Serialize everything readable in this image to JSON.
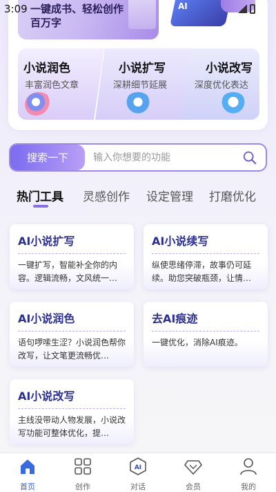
{
  "status": {
    "time": "3:09"
  },
  "hero": {
    "line1": "一键成书、轻松创作",
    "line2": "百万字",
    "badge": "AI"
  },
  "features": [
    {
      "title": "小说润色",
      "subtitle": "丰富润色文章"
    },
    {
      "title": "小说扩写",
      "subtitle": "深耕细节延展"
    },
    {
      "title": "小说改写",
      "subtitle": "深度优化表达"
    }
  ],
  "search": {
    "button_label": "搜索一下",
    "placeholder": "输入你想要的功能",
    "value": ""
  },
  "tabs": [
    {
      "label": "热门工具",
      "active": true
    },
    {
      "label": "灵感创作",
      "active": false
    },
    {
      "label": "设定管理",
      "active": false
    },
    {
      "label": "打磨优化",
      "active": false
    }
  ],
  "tools": [
    {
      "title": "AI小说扩写",
      "desc": "一键扩写，智能补全你的内容。逻辑流畅，文风统一…"
    },
    {
      "title": "AI小说续写",
      "desc": "纵使思绪停滞，故事仍可延续。助您突破瓶颈，让情…"
    },
    {
      "title": "AI小说润色",
      "desc": "语句啰嗦生涩？小说润色帮你改写，让文笔更流畅优…"
    },
    {
      "title": "去AI痕迹",
      "desc": "一键优化，消除AI痕迹。"
    },
    {
      "title": "AI小说改写",
      "desc": "主线没带动人物发展，小说改写功能可整体优化，提…"
    }
  ],
  "nav": [
    {
      "label": "首页",
      "icon": "home-icon",
      "active": true
    },
    {
      "label": "创作",
      "icon": "grid-icon",
      "active": false
    },
    {
      "label": "对话",
      "icon": "ai-chat-icon",
      "active": false,
      "badge": "AI"
    },
    {
      "label": "会员",
      "icon": "diamond-icon",
      "active": false
    },
    {
      "label": "我的",
      "icon": "user-icon",
      "active": false
    }
  ],
  "colors": {
    "accent": "#8a70e6",
    "nav_active": "#2d5dd8",
    "card_title": "#2b2f8f"
  }
}
